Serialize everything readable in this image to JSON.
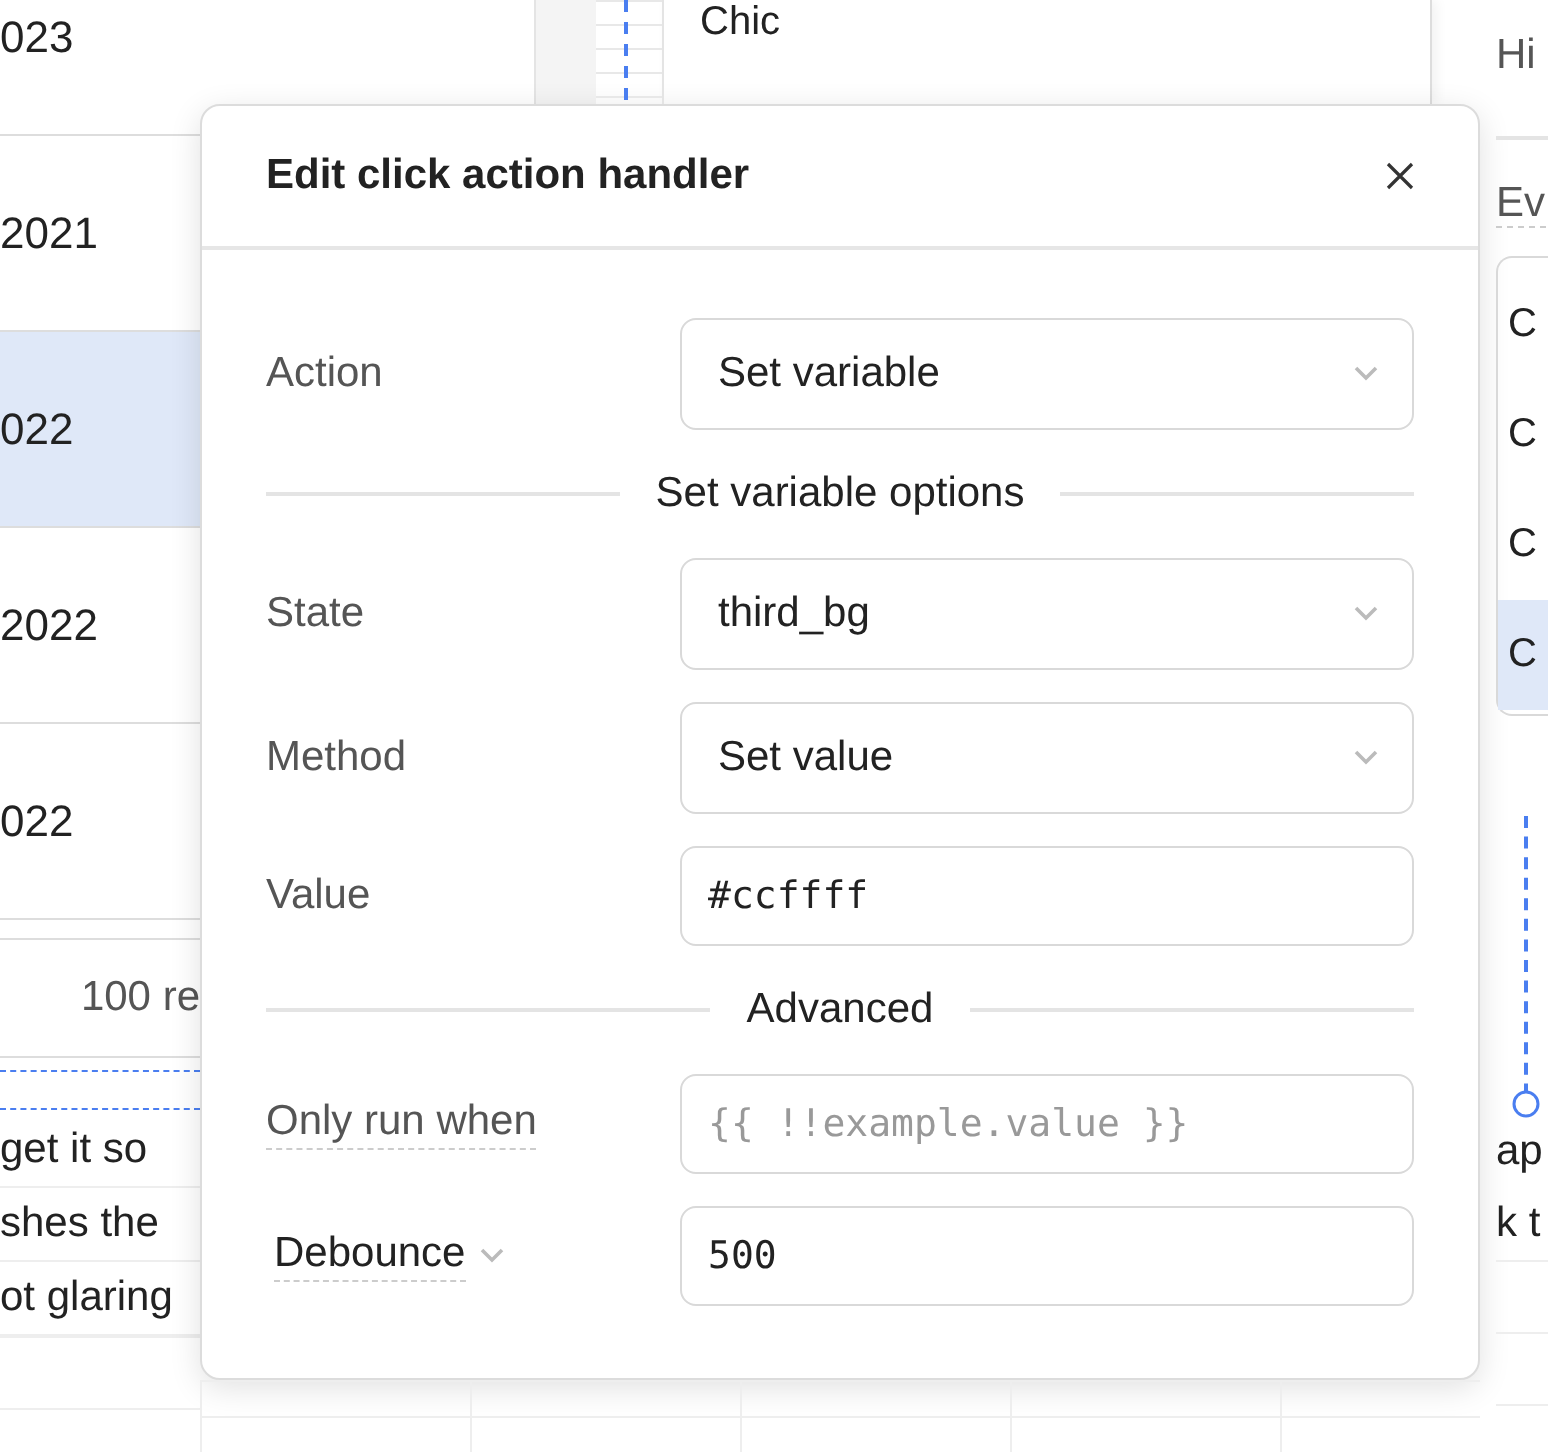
{
  "background": {
    "table_cells": [
      {
        "text": "023",
        "selected": false
      },
      {
        "text": "2021",
        "selected": false
      },
      {
        "text": "022",
        "selected": true
      },
      {
        "text": "2022",
        "selected": false
      },
      {
        "text": "022",
        "selected": false
      }
    ],
    "table_footer": "100 re",
    "text_lines": [
      "get it so",
      "shes the",
      "ot glaring"
    ],
    "middle_panel_text": "Chic",
    "right_panel": {
      "label": "Hi",
      "events_label": "Ev",
      "list_items": [
        {
          "text": "C",
          "selected": false
        },
        {
          "text": "C",
          "selected": false
        },
        {
          "text": "C",
          "selected": false
        },
        {
          "text": "C",
          "selected": true
        }
      ],
      "text_lines": [
        "ap",
        "k t"
      ]
    }
  },
  "dialog": {
    "title": "Edit click action handler",
    "fields": [
      {
        "kind": "select",
        "label": "Action",
        "value": "Set variable"
      },
      {
        "kind": "section",
        "title": "Set variable options"
      },
      {
        "kind": "select",
        "label": "State",
        "value": "third_bg"
      },
      {
        "kind": "select",
        "label": "Method",
        "value": "Set value"
      },
      {
        "kind": "code",
        "label": "Value",
        "value": "#ccffff"
      },
      {
        "kind": "section",
        "title": "Advanced"
      },
      {
        "kind": "code",
        "label": "Only run when",
        "placeholder": "{{ !!example.value }}",
        "hint": true
      },
      {
        "kind": "code",
        "label": "Debounce",
        "value": "500",
        "hint": true,
        "label_menu": true
      }
    ]
  }
}
